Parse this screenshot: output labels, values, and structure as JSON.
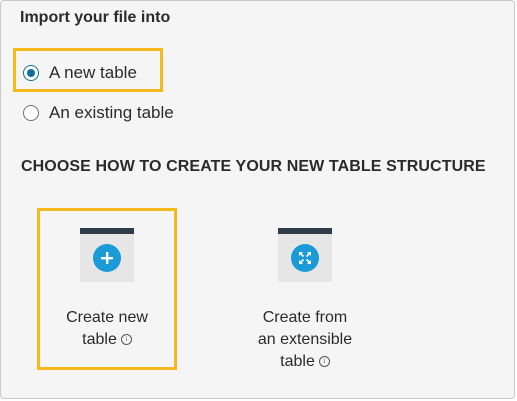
{
  "import": {
    "heading": "Import your file into",
    "options": [
      {
        "label": "A new table",
        "selected": true
      },
      {
        "label": "An existing table",
        "selected": false
      }
    ]
  },
  "structure": {
    "title": "CHOOSE HOW TO CREATE YOUR NEW TABLE STRUCTURE",
    "cards": [
      {
        "line1": "Create new",
        "line2": "table",
        "icon": "plus-icon",
        "selected": true
      },
      {
        "line1": "Create from",
        "line2": "an extensible",
        "line3": "table",
        "icon": "expand-icon",
        "selected": false
      }
    ]
  },
  "colors": {
    "accent": "#1a9ad6",
    "highlight": "#f6b81b",
    "radio": "#0f6e9b"
  }
}
